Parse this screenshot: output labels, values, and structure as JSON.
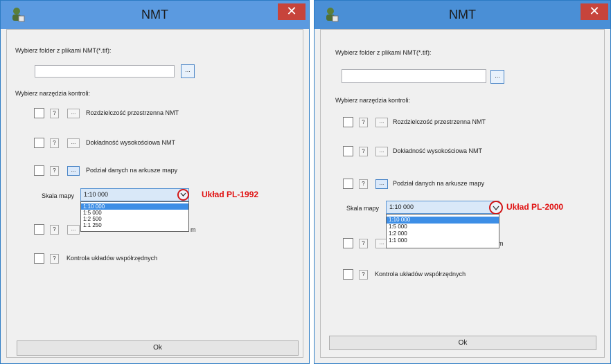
{
  "dialogs": [
    {
      "title": "NMT",
      "close_label": "✕",
      "folder_label": "Wybierz folder z plikami NMT(*.tif):",
      "folder_value": "",
      "browse_label": "...",
      "tools_label": "Wybierz narzędzia kontroli:",
      "tools": [
        {
          "help": "?",
          "more": "...",
          "label": "Rozdzielczość przestrzenna NMT"
        },
        {
          "help": "?",
          "more": "...",
          "label": "Dokładność wysokościowa NMT"
        },
        {
          "help": "?",
          "more": "...",
          "label": "Podział danych na arkusze mapy"
        },
        {
          "help": "?",
          "more": "...",
          "label": "m"
        },
        {
          "help": "?",
          "label": "Kontrola układów współrzędnych"
        }
      ],
      "scale_label": "Skala mapy",
      "scale_value": "1:10 000",
      "scale_options": [
        "1:10 000",
        "1:5 000",
        "1:2 500",
        "1:1 250"
      ],
      "annotation": "Układ PL-1992",
      "ok_label": "Ok"
    },
    {
      "title": "NMT",
      "close_label": "✕",
      "folder_label": "Wybierz folder z plikami NMT(*.tif):",
      "folder_value": "",
      "browse_label": "...",
      "tools_label": "Wybierz narzędzia kontroli:",
      "tools": [
        {
          "help": "?",
          "more": "...",
          "label": "Rozdzielczość przestrzenna NMT"
        },
        {
          "help": "?",
          "more": "...",
          "label": "Dokładność wysokościowa NMT"
        },
        {
          "help": "?",
          "more": "...",
          "label": "Podział danych na arkusze mapy"
        },
        {
          "help": "?",
          "more": "...",
          "label": "m"
        },
        {
          "help": "?",
          "label": "Kontrola układów współrzędnych"
        }
      ],
      "scale_label": "Skala mapy",
      "scale_value": "1:10 000",
      "scale_options": [
        "1:10 000",
        "1:5 000",
        "1:2 000",
        "1:1 000"
      ],
      "annotation": "Układ PL-2000",
      "ok_label": "Ok"
    }
  ],
  "colors": {
    "accent": "#4a8fd6",
    "close": "#c7443b",
    "annotation": "#e01010",
    "selected": "#3d8ee6"
  },
  "icons": {
    "app": "user-icon",
    "close": "close-icon",
    "dropdown": "chevron-down-icon"
  }
}
